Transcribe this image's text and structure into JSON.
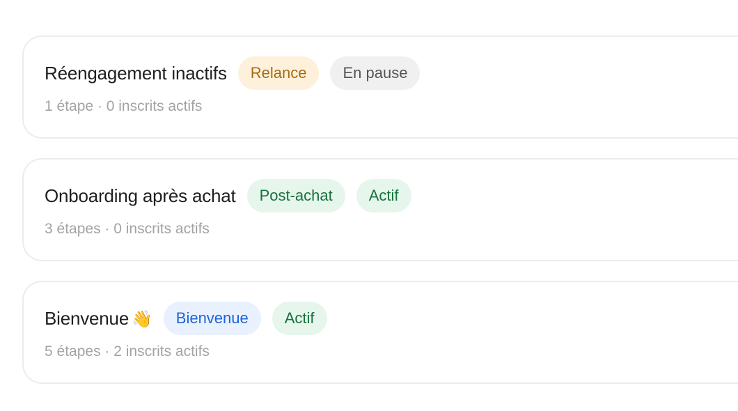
{
  "sequences": [
    {
      "title": "Réengagement inactifs",
      "tag": "Relance",
      "status": "En pause",
      "meta": "1 étape · 0 inscrits actifs"
    },
    {
      "title": "Onboarding après achat",
      "tag": "Post-achat",
      "status": "Actif",
      "meta": "3 étapes · 0 inscrits actifs"
    },
    {
      "title": "Bienvenue",
      "emoji": "👋",
      "tag": "Bienvenue",
      "status": "Actif",
      "meta": "5 étapes · 2 inscrits actifs"
    }
  ],
  "colors": {
    "tag_relance_bg": "#fdf1dc",
    "tag_relance_text": "#a86a12",
    "tag_postachat_bg": "#e6f6ec",
    "tag_postachat_text": "#17713d",
    "tag_bienvenue_bg": "#e9f1fe",
    "tag_bienvenue_text": "#1f63d8",
    "status_pause_bg": "#f0f0f0",
    "status_pause_text": "#555555",
    "status_actif_bg": "#e6f6ec",
    "status_actif_text": "#17713d"
  }
}
